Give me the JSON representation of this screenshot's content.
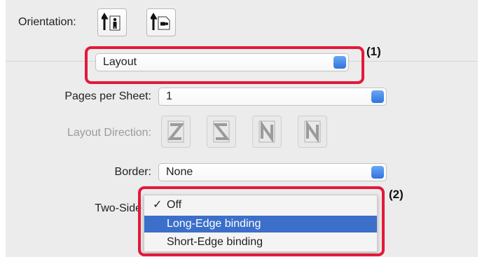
{
  "orientation": {
    "label": "Orientation:",
    "options": [
      "portrait-icon",
      "landscape-icon"
    ]
  },
  "section_select": {
    "value": "Layout"
  },
  "pages_per_sheet": {
    "label": "Pages per Sheet:",
    "value": "1"
  },
  "layout_direction": {
    "label": "Layout Direction:",
    "options": [
      "Z",
      "S",
      "N-reverse",
      "N"
    ]
  },
  "border": {
    "label": "Border:",
    "value": "None"
  },
  "two_sided": {
    "label": "Two-Sided:",
    "visible_label": "Two-Side",
    "menu": [
      {
        "label": "Off",
        "checked": true,
        "highlighted": false
      },
      {
        "label": "Long-Edge binding",
        "checked": false,
        "highlighted": true
      },
      {
        "label": "Short-Edge binding",
        "checked": false,
        "highlighted": false
      }
    ],
    "check_glyph": "✓"
  },
  "callouts": {
    "one": "(1)",
    "two": "(2)"
  },
  "colors": {
    "highlight_box": "#e3193b",
    "selection": "#3b6fc9",
    "accent": "#2f73e0"
  }
}
